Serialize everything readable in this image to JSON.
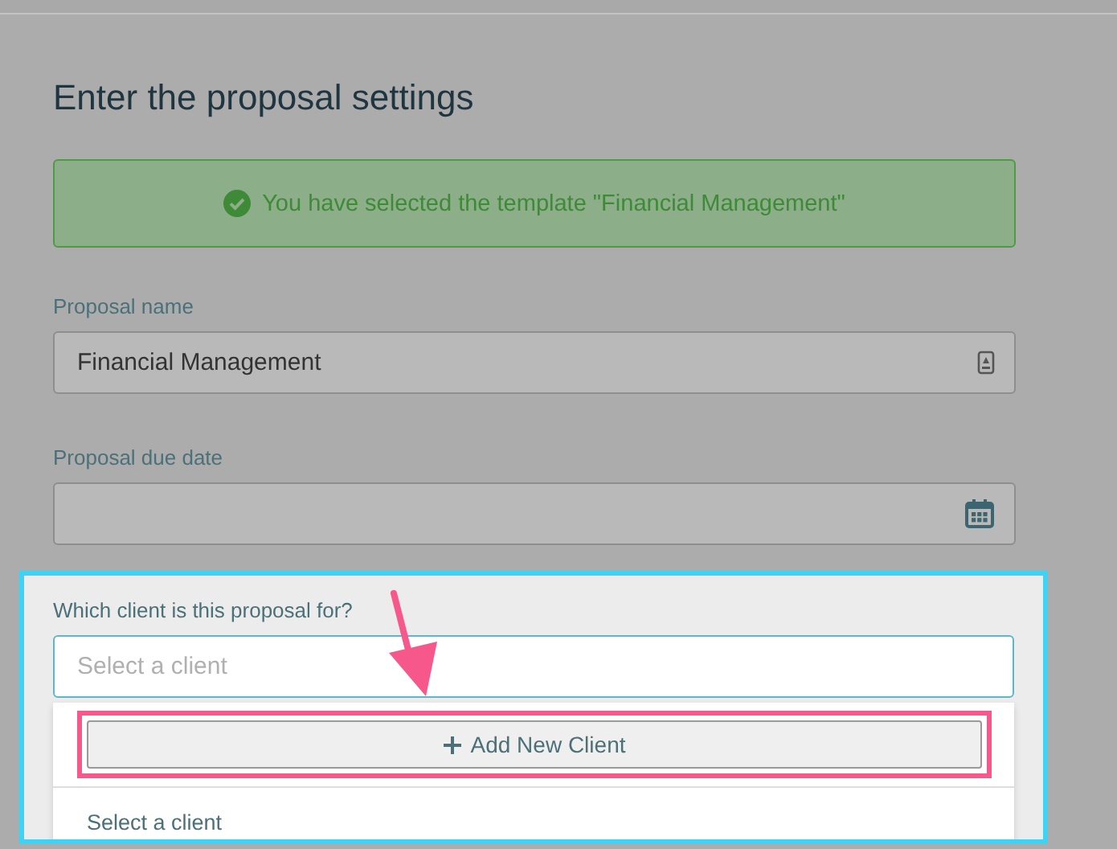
{
  "heading": "Enter the proposal settings",
  "alert": {
    "kind": "success",
    "text": "You have selected the template \"Financial Management\""
  },
  "fields": [
    {
      "label": "Proposal name",
      "kind": "text",
      "value": "Financial Management"
    },
    {
      "label": "Proposal due date",
      "kind": "date"
    }
  ],
  "client_select": {
    "label": "Which client is this proposal for?",
    "placeholder": "Select a client",
    "expanded": true,
    "add_button": {
      "label": "Add New Client"
    },
    "options": [
      {
        "label": "Select a client"
      }
    ]
  }
}
